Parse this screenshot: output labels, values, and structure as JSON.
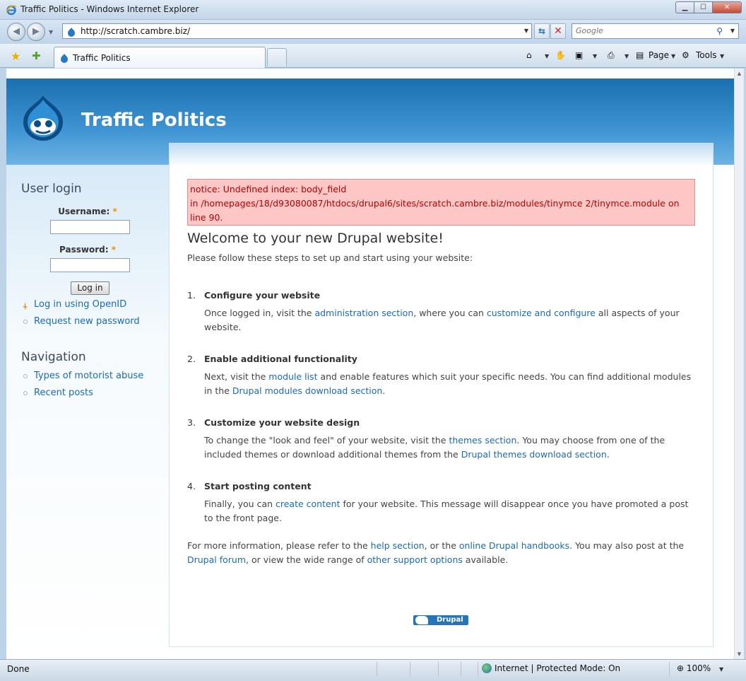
{
  "window": {
    "title": "Traffic Politics - Windows Internet Explorer",
    "minimize_glyph": "▁",
    "maximize_glyph": "☐",
    "close_glyph": "✕"
  },
  "nav": {
    "back_glyph": "◀",
    "forward_glyph": "▶",
    "url": "http://scratch.cambre.biz/",
    "search_placeholder": "Google",
    "refresh_glyph": "⇆",
    "stop_glyph": "✕"
  },
  "tabs": [
    {
      "label": "Traffic Politics"
    }
  ],
  "commands": {
    "page_label": "Page",
    "tools_label": "Tools"
  },
  "site": {
    "name": "Traffic Politics"
  },
  "sidebar": {
    "login_title": "User login",
    "username_label": "Username:",
    "password_label": "Password:",
    "required_mark": "*",
    "login_button": "Log in",
    "openid_link": "Log in using OpenID",
    "new_password_link": "Request new password",
    "nav_title": "Navigation",
    "nav_items": [
      {
        "label": "Types of motorist abuse"
      },
      {
        "label": "Recent posts"
      }
    ]
  },
  "main": {
    "notice_line1": "notice: Undefined index: body_field",
    "notice_line2": "in /homepages/18/d93080087/htdocs/drupal6/sites/scratch.cambre.biz/modules/tinymce 2/tinymce.module on",
    "notice_line3": "line 90.",
    "welcome": "Welcome to your new Drupal website!",
    "intro": "Please follow these steps to set up and start using your website:",
    "steps": [
      {
        "num": "1.",
        "title": "Configure your website",
        "t1": "Once logged in, visit the ",
        "l1": "administration section",
        "t2": ", where you can ",
        "l2": "customize and configure",
        "t3": " all aspects of your website."
      },
      {
        "num": "2.",
        "title": "Enable additional functionality",
        "t1": "Next, visit the ",
        "l1": "module list",
        "t2": " and enable features which suit your specific needs. You can find additional modules in the ",
        "l2": "Drupal modules download section",
        "t3": "."
      },
      {
        "num": "3.",
        "title": "Customize your website design",
        "t1": "To change the \"look and feel\" of your website, visit the ",
        "l1": "themes section",
        "t2": ". You may choose from one of the included themes or download additional themes from the ",
        "l2": "Drupal themes download section",
        "t3": "."
      },
      {
        "num": "4.",
        "title": "Start posting content",
        "t1": "Finally, you can ",
        "l1": "create content",
        "t2": " for your website. This message will disappear once you have promoted a post to the front page.",
        "l2": "",
        "t3": ""
      }
    ],
    "more": {
      "t1": "For more information, please refer to the ",
      "l1": "help section",
      "t2": ", or the ",
      "l2": "online Drupal handbooks",
      "t3": ". You may also post at the ",
      "l3": "Drupal forum",
      "t4": ", or view the wide range of ",
      "l4": "other support options",
      "t5": " available."
    },
    "powered_by": "Drupal"
  },
  "status": {
    "text": "Done",
    "zone": "Internet | Protected Mode: On",
    "zoom": "100%"
  }
}
